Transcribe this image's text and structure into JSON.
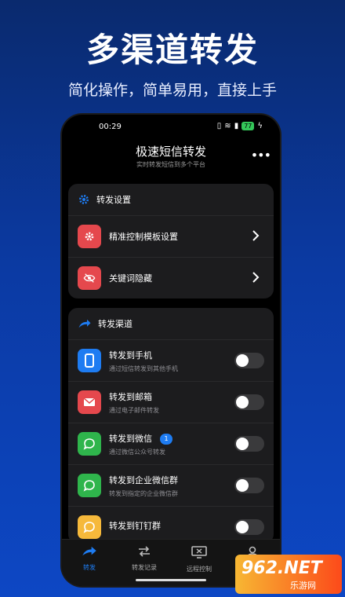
{
  "promo": {
    "headline": "多渠道转发",
    "subheadline": "简化操作，简单易用，直接上手"
  },
  "statusbar": {
    "time": "00:29",
    "battery": "77"
  },
  "app": {
    "title": "极速短信转发",
    "subtitle": "实时转发短信到多个平台",
    "more_label": "•••"
  },
  "settings_card": {
    "title": "转发设置",
    "items": [
      {
        "label": "精准控制模板设置",
        "icon": "gear-icon",
        "color": "#e5484d"
      },
      {
        "label": "关键词隐藏",
        "icon": "eye-off-icon",
        "color": "#e5484d"
      }
    ]
  },
  "channels_card": {
    "title": "转发渠道",
    "items": [
      {
        "title": "转发到手机",
        "desc": "通过短信转发到其他手机",
        "icon": "phone-icon",
        "color": "#1e7cf2",
        "enabled": false
      },
      {
        "title": "转发到邮箱",
        "desc": "通过电子邮件转发",
        "icon": "mail-icon",
        "color": "#e5484d",
        "enabled": false
      },
      {
        "title": "转发到微信",
        "desc": "通过微信公众号转发",
        "icon": "chat-icon",
        "color": "#2fb54c",
        "badge": "1",
        "enabled": false
      },
      {
        "title": "转发到企业微信群",
        "desc": "转发到指定的企业微信群",
        "icon": "chat-icon",
        "color": "#2fb54c",
        "enabled": false
      },
      {
        "title": "转发到钉钉群",
        "desc": "",
        "icon": "chat-icon",
        "color": "#f6b93b",
        "enabled": false
      }
    ]
  },
  "tabbar": {
    "tabs": [
      {
        "label": "转发",
        "active": true
      },
      {
        "label": "转发记录",
        "active": false
      },
      {
        "label": "远程控制",
        "active": false
      },
      {
        "label": "",
        "active": false
      }
    ]
  },
  "watermark": {
    "logo": "962.NET",
    "sub": "乐游网"
  },
  "colors": {
    "accent": "#1e7cf2",
    "danger": "#e5484d",
    "success": "#2fb54c"
  }
}
